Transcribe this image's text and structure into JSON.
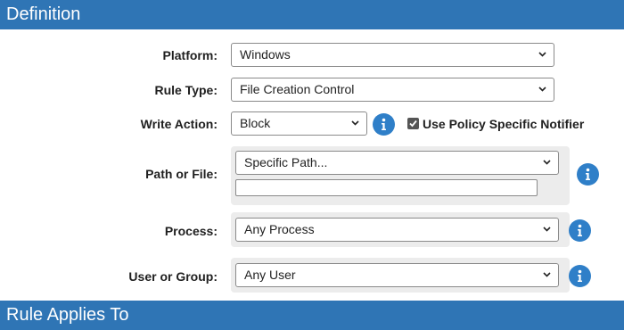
{
  "sections": {
    "definition_title": "Definition",
    "rule_applies_title": "Rule Applies To"
  },
  "platform": {
    "label": "Platform:",
    "value": "Windows"
  },
  "rule_type": {
    "label": "Rule Type:",
    "value": "File Creation Control"
  },
  "write_action": {
    "label": "Write Action:",
    "value": "Block",
    "notifier_label": "Use Policy Specific Notifier",
    "notifier_checked": true
  },
  "path_or_file": {
    "label": "Path or File:",
    "value": "Specific Path...",
    "path_text": ""
  },
  "process": {
    "label": "Process:",
    "value": "Any Process"
  },
  "user_or_group": {
    "label": "User or Group:",
    "value": "Any User"
  },
  "icons": {
    "info": "info-icon",
    "dropdown": "chevron-down-icon",
    "check": "checkmark-icon"
  },
  "colors": {
    "header_bg": "#2f75b5",
    "info_bg": "#2f7fc8",
    "panel_bg": "#ececec"
  }
}
